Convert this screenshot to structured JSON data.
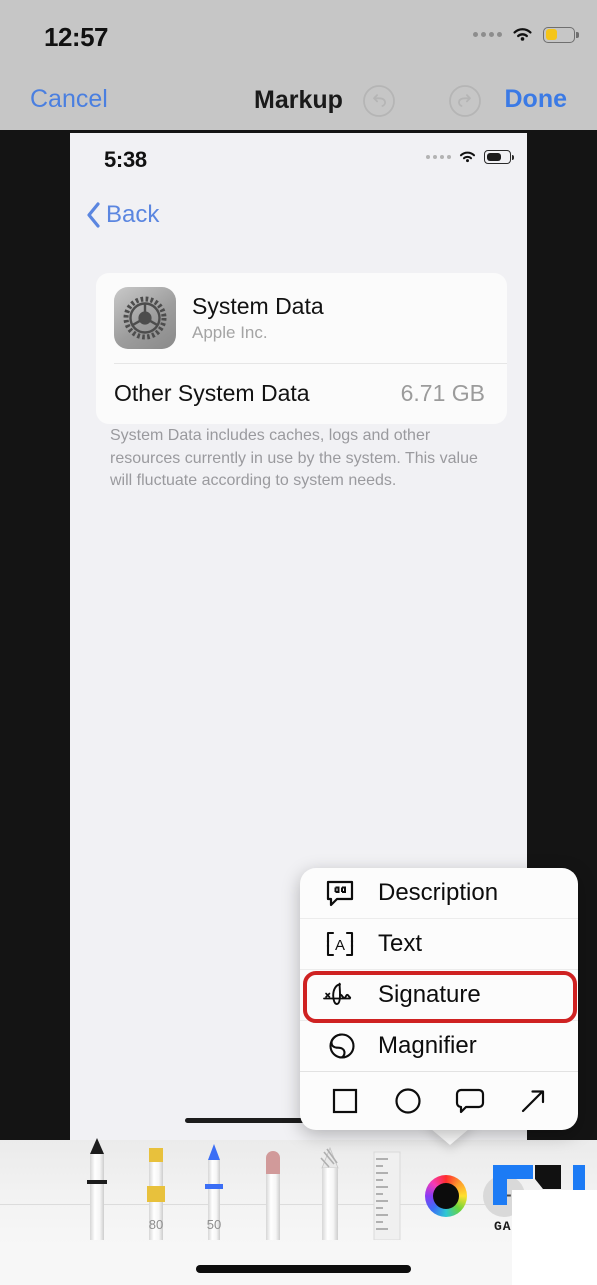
{
  "markup_chrome": {
    "status": {
      "time": "12:57",
      "cellular_icon": "cellular-dots-icon",
      "wifi_icon": "wifi-icon",
      "battery_icon": "battery-low-power-icon",
      "battery_color": "#f5c518",
      "battery_level_pct": 38
    },
    "cancel_label": "Cancel",
    "title": "Markup",
    "done_label": "Done",
    "undo_icon": "undo-icon",
    "redo_icon": "redo-icon",
    "bar_color": "#c6c6c6",
    "accent_color": "#3b7ae5"
  },
  "inner_screenshot": {
    "status": {
      "time": "5:38",
      "cellular_icon": "cellular-dots-icon",
      "wifi_icon": "wifi-icon",
      "battery_icon": "battery-icon",
      "battery_color": "#1c1c1c",
      "battery_level_pct": 62
    },
    "back_label": "Back",
    "back_icon": "chevron-left-icon",
    "card": {
      "app_icon": "settings-gear-icon",
      "app_name": "System Data",
      "app_vendor": "Apple Inc.",
      "row_label": "Other System Data",
      "row_value": "6.71 GB"
    },
    "note": "System Data includes caches, logs and other resources currently in use by the system. This value will fluctuate according to system needs."
  },
  "markup_menu": {
    "items": [
      {
        "label": "Description",
        "icon": "speech-bubble-quote-icon",
        "highlighted": false
      },
      {
        "label": "Text",
        "icon": "text-box-a-icon",
        "highlighted": false
      },
      {
        "label": "Signature",
        "icon": "signature-icon",
        "highlighted": true
      },
      {
        "label": "Magnifier",
        "icon": "magnifier-icon",
        "highlighted": false
      }
    ],
    "shapes": [
      {
        "name": "square-shape-icon"
      },
      {
        "name": "circle-shape-icon"
      },
      {
        "name": "speech-bubble-shape-icon"
      },
      {
        "name": "arrow-shape-icon"
      }
    ],
    "highlight_color": "#cf2222"
  },
  "toolbar": {
    "tools": [
      {
        "name": "pen-tool",
        "label": "",
        "color": "#1c1c1c"
      },
      {
        "name": "highlighter-tool",
        "label": "80",
        "color": "#e8c13c"
      },
      {
        "name": "marker-tool",
        "label": "50",
        "color": "#3b6ef5"
      },
      {
        "name": "eraser-tool",
        "label": "",
        "color": "#d19a9a"
      },
      {
        "name": "lasso-tool",
        "label": "",
        "color": "#b4b4b4"
      },
      {
        "name": "ruler-tool",
        "label": "",
        "color": "#e4e4e4"
      }
    ],
    "color_wheel_icon": "color-wheel-icon",
    "selected_color": "#0c0c0c",
    "add_label": "+"
  },
  "watermark": {
    "text": "GAD",
    "color": "#1c7bf5"
  }
}
